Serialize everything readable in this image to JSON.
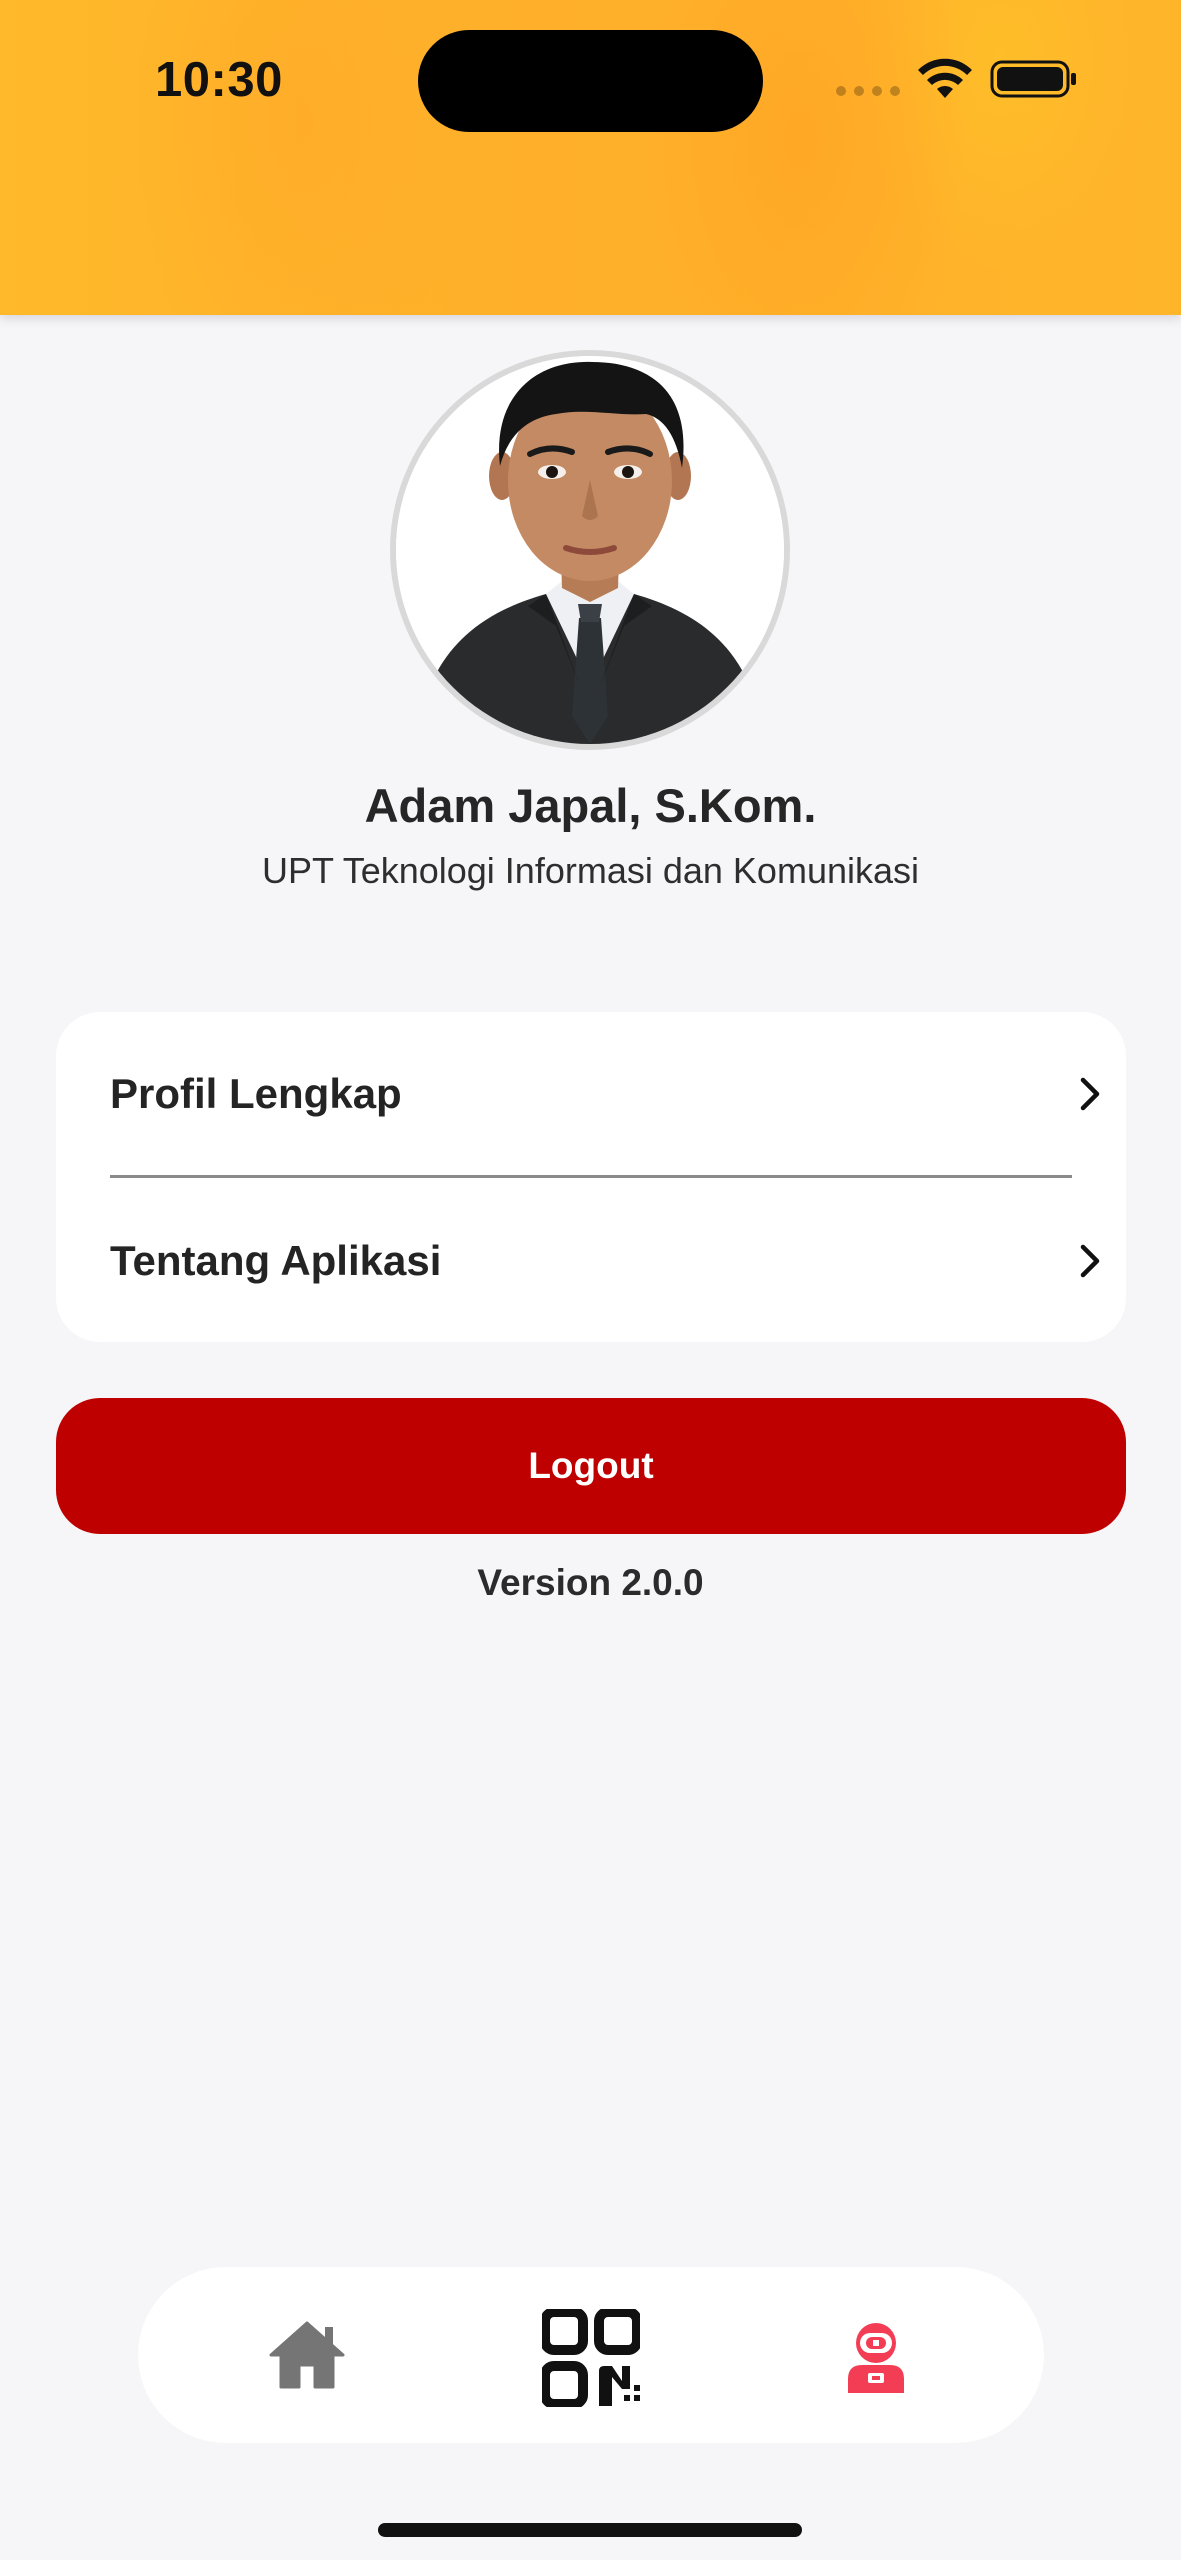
{
  "status_bar": {
    "time": "10:30"
  },
  "profile": {
    "name": "Adam Japal, S.Kom.",
    "unit": "UPT Teknologi Informasi dan Komunikasi",
    "avatar_icon": "user-photo"
  },
  "menu": {
    "items": [
      {
        "label": "Profil Lengkap",
        "icon": "chevron-right-icon"
      },
      {
        "label": "Tentang Aplikasi",
        "icon": "chevron-right-icon"
      }
    ]
  },
  "logout": {
    "label": "Logout"
  },
  "version": "Version 2.0.0",
  "bottom_nav": {
    "items": [
      {
        "name": "home",
        "icon": "home-icon",
        "active": false
      },
      {
        "name": "scan",
        "icon": "qr-code-icon",
        "active": false
      },
      {
        "name": "profile",
        "icon": "astronaut-icon",
        "active": true
      }
    ]
  },
  "colors": {
    "header": "#ffb52a",
    "logout": "#bf0000",
    "active_nav": "#f23d55",
    "inactive_nav": "#757575",
    "background": "#f6f5f8"
  }
}
